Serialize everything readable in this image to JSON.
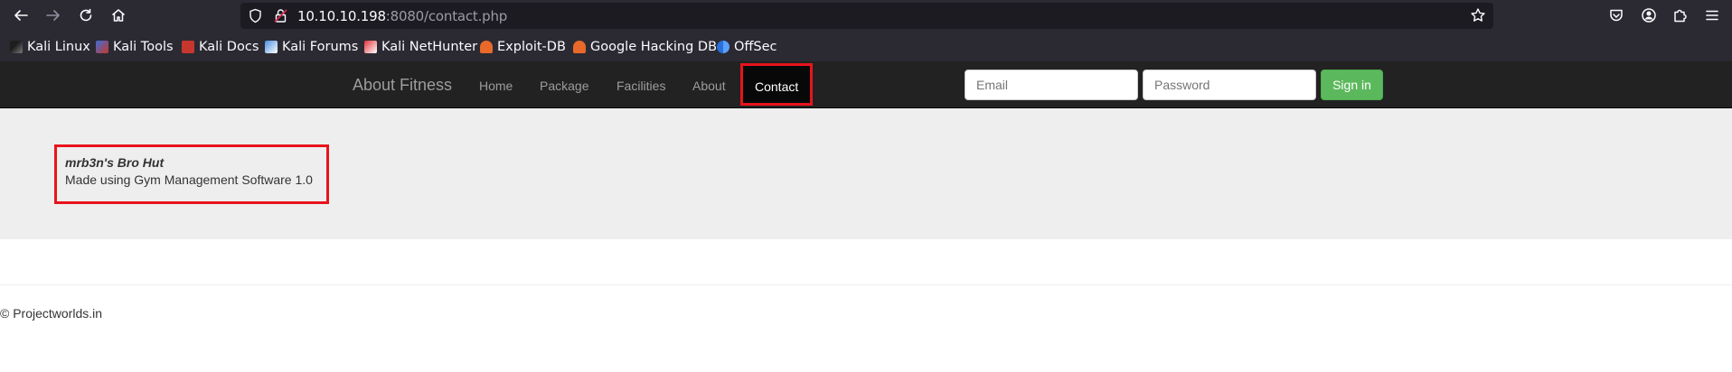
{
  "browser": {
    "url_host": "10.10.10.198",
    "url_rest": ":8080/contact.php",
    "bookmarks": [
      {
        "label": "Kali Linux",
        "icon": "kali-dragon-icon"
      },
      {
        "label": "Kali Tools",
        "icon": "kali-tools-icon"
      },
      {
        "label": "Kali Docs",
        "icon": "kali-docs-icon"
      },
      {
        "label": "Kali Forums",
        "icon": "kali-forums-icon"
      },
      {
        "label": "Kali NetHunter",
        "icon": "kali-nethunter-icon"
      },
      {
        "label": "Exploit-DB",
        "icon": "exploit-db-icon"
      },
      {
        "label": "Google Hacking DB",
        "icon": "google-hacking-db-icon"
      },
      {
        "label": "OffSec",
        "icon": "offsec-icon"
      }
    ]
  },
  "navbar": {
    "brand": "About Fitness",
    "links": [
      "Home",
      "Package",
      "Facilities",
      "About"
    ],
    "active_link": "Contact",
    "email_placeholder": "Email",
    "password_placeholder": "Password",
    "signin_label": "Sign in",
    "signin_color": "#5cb85c",
    "highlight_color": "#e8141c"
  },
  "jumbotron": {
    "title": "mrb3n's Bro Hut",
    "subtitle": "Made using Gym Management Software 1.0"
  },
  "footer": {
    "copyright": "© Projectworlds.in"
  }
}
